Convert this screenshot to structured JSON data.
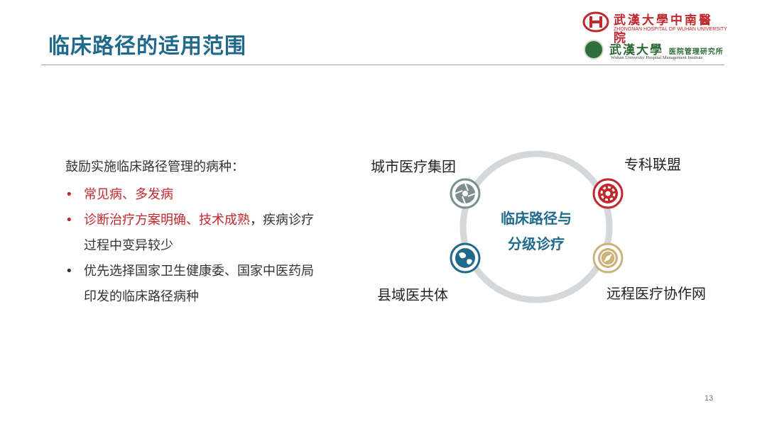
{
  "header": {
    "title": "临床路径的适用范围"
  },
  "logos": {
    "hospital_cn": "武漢大學中南醫院",
    "hospital_en": "ZHONGNAN HOSPITAL OF WUHAN UNIVERSITY",
    "institute_cn_main": "武漢大學",
    "institute_cn_sub": "医院管理研究所",
    "institute_en": "Wuhan University Hospital Management Institute"
  },
  "content": {
    "intro": "鼓励实施临床路径管理的病种：",
    "bullets": [
      {
        "text": "常见病、多发病",
        "highlight": true
      },
      {
        "text_red": "诊断治疗方案明确、技术成熟",
        "text_rest": "，疾病诊疗过程中变异较少"
      },
      {
        "text": "优先选择国家卫生健康委、国家中医药局印发的临床路径病种",
        "highlight": false
      }
    ],
    "bullet_char": "•"
  },
  "diagram": {
    "center_line1": "临床路径与",
    "center_line2": "分级诊疗",
    "nodes": [
      {
        "label": "城市医疗集团",
        "icon": "aperture-icon",
        "color": "#7f8c94"
      },
      {
        "label": "专科联盟",
        "icon": "gear-icon",
        "color": "#c0282d"
      },
      {
        "label": "县域医共体",
        "icon": "globe-icon",
        "color": "#1f6a8c"
      },
      {
        "label": "远程医疗协作网",
        "icon": "compass-icon",
        "color": "#c9b27c"
      }
    ],
    "ring_color": "#d4d8db"
  },
  "footer": {
    "page_number": "13"
  },
  "colors": {
    "title": "#1f6a8c",
    "accent_red": "#c0282d",
    "text": "#333333"
  }
}
